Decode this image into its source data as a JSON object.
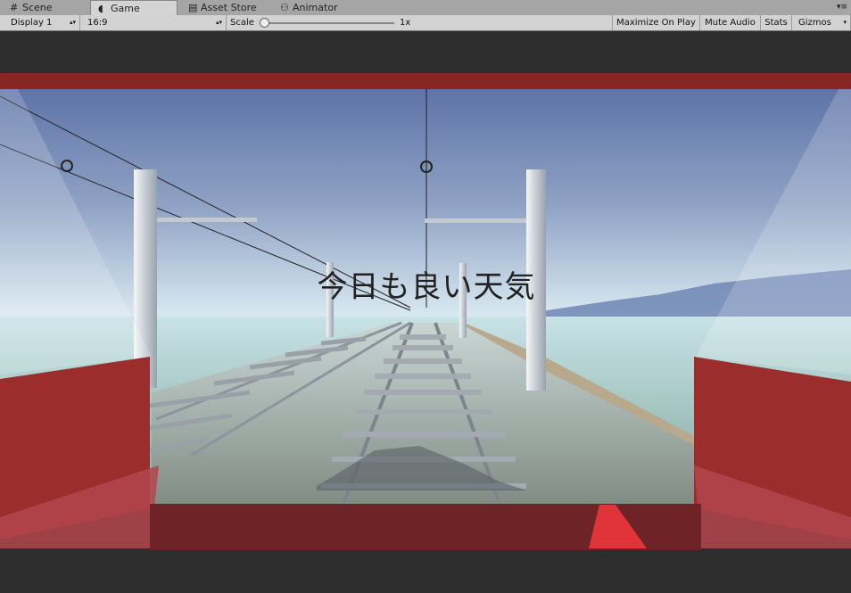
{
  "tabs": [
    {
      "label": "Scene",
      "icon": "grid-icon"
    },
    {
      "label": "Game",
      "icon": "pacman-icon",
      "active": true
    },
    {
      "label": "Asset Store",
      "icon": "store-icon"
    },
    {
      "label": "Animator",
      "icon": "animator-icon"
    }
  ],
  "toolbar": {
    "display": "Display 1",
    "aspect": "16:9",
    "scale_label": "Scale",
    "scale_value": "1x",
    "maximize_on_play": "Maximize On Play",
    "mute_audio": "Mute Audio",
    "stats": "Stats",
    "gizmos": "Gizmos"
  },
  "game": {
    "caption": "今日も良い天気"
  },
  "colors": {
    "sky_top": "#5e74a8",
    "sky_horizon": "#d9ecf2",
    "sea": "#96bcb8",
    "cab_red": "#8c2a2a",
    "letterbox": "#2d2d2d"
  }
}
